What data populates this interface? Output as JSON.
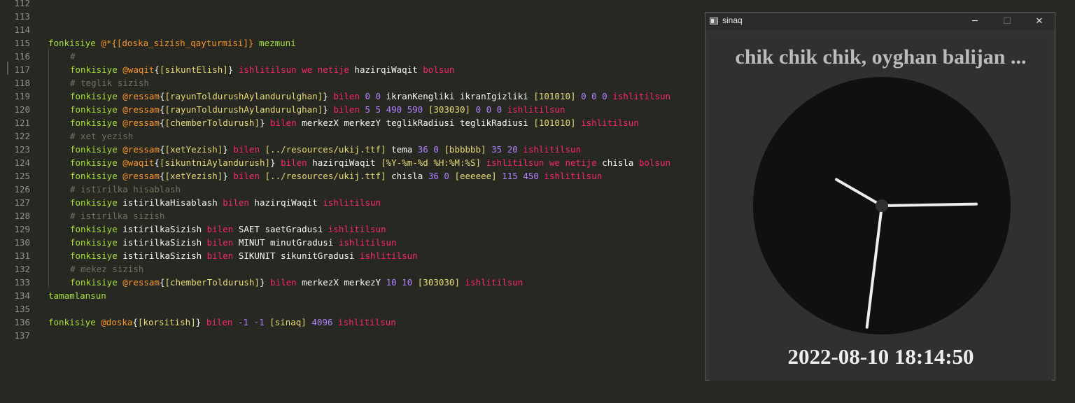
{
  "editor": {
    "lines": [
      {
        "num": "112",
        "indent": false,
        "tokens": []
      },
      {
        "num": "113",
        "indent": false,
        "tokens": []
      },
      {
        "num": "114",
        "indent": false,
        "tokens": []
      },
      {
        "num": "115",
        "indent": false,
        "tokens": [
          [
            "kw",
            "fonkisiye"
          ],
          [
            "fn",
            " "
          ],
          [
            "an",
            "@*{[doska_sizish_qayturmisi]}"
          ],
          [
            "fn",
            " "
          ],
          [
            "df",
            "mezmuni"
          ]
        ]
      },
      {
        "num": "116",
        "indent": true,
        "tokens": [
          [
            "cm",
            "#"
          ]
        ]
      },
      {
        "num": "117",
        "indent": true,
        "tokens": [
          [
            "kw",
            "fonkisiye"
          ],
          [
            "fn",
            " "
          ],
          [
            "an",
            "@waqit"
          ],
          [
            "fn",
            "{"
          ],
          [
            "st",
            "[sikuntElish]"
          ],
          [
            "fn",
            "}"
          ],
          [
            "fn",
            " "
          ],
          [
            "pk",
            "ishlitilsun we netije"
          ],
          [
            "fn",
            " hazirqiWaqit "
          ],
          [
            "pk",
            "bolsun"
          ]
        ]
      },
      {
        "num": "118",
        "indent": true,
        "tokens": [
          [
            "cm",
            "# teglik sizish"
          ]
        ]
      },
      {
        "num": "119",
        "indent": true,
        "tokens": [
          [
            "kw",
            "fonkisiye"
          ],
          [
            "fn",
            " "
          ],
          [
            "an",
            "@ressam"
          ],
          [
            "fn",
            "{"
          ],
          [
            "st",
            "[rayunToldurushAylandurulghan]"
          ],
          [
            "fn",
            "}"
          ],
          [
            "fn",
            " "
          ],
          [
            "pk",
            "bilen"
          ],
          [
            "fn",
            " "
          ],
          [
            "nm",
            "0 0"
          ],
          [
            "fn",
            " ikranKengliki ikranIgizliki "
          ],
          [
            "st",
            "[101010]"
          ],
          [
            "fn",
            " "
          ],
          [
            "nm",
            "0 0 0"
          ],
          [
            "fn",
            " "
          ],
          [
            "pk",
            "ishlitilsun"
          ]
        ]
      },
      {
        "num": "120",
        "indent": true,
        "tokens": [
          [
            "kw",
            "fonkisiye"
          ],
          [
            "fn",
            " "
          ],
          [
            "an",
            "@ressam"
          ],
          [
            "fn",
            "{"
          ],
          [
            "st",
            "[rayunToldurushAylandurulghan]"
          ],
          [
            "fn",
            "}"
          ],
          [
            "fn",
            " "
          ],
          [
            "pk",
            "bilen"
          ],
          [
            "fn",
            " "
          ],
          [
            "nm",
            "5 5 490 590"
          ],
          [
            "fn",
            " "
          ],
          [
            "st",
            "[303030]"
          ],
          [
            "fn",
            " "
          ],
          [
            "nm",
            "0 0 0"
          ],
          [
            "fn",
            " "
          ],
          [
            "pk",
            "ishlitilsun"
          ]
        ]
      },
      {
        "num": "121",
        "indent": true,
        "tokens": [
          [
            "kw",
            "fonkisiye"
          ],
          [
            "fn",
            " "
          ],
          [
            "an",
            "@ressam"
          ],
          [
            "fn",
            "{"
          ],
          [
            "st",
            "[chemberToldurush]"
          ],
          [
            "fn",
            "}"
          ],
          [
            "fn",
            " "
          ],
          [
            "pk",
            "bilen"
          ],
          [
            "fn",
            " merkezX merkezY teglikRadiusi teglikRadiusi "
          ],
          [
            "st",
            "[101010]"
          ],
          [
            "fn",
            " "
          ],
          [
            "pk",
            "ishlitilsun"
          ]
        ]
      },
      {
        "num": "122",
        "indent": true,
        "tokens": [
          [
            "cm",
            "# xet yezish"
          ]
        ]
      },
      {
        "num": "123",
        "indent": true,
        "tokens": [
          [
            "kw",
            "fonkisiye"
          ],
          [
            "fn",
            " "
          ],
          [
            "an",
            "@ressam"
          ],
          [
            "fn",
            "{"
          ],
          [
            "st",
            "[xetYezish]"
          ],
          [
            "fn",
            "}"
          ],
          [
            "fn",
            " "
          ],
          [
            "pk",
            "bilen"
          ],
          [
            "fn",
            " "
          ],
          [
            "st",
            "[../resources/ukij.ttf]"
          ],
          [
            "fn",
            " tema "
          ],
          [
            "nm",
            "36 0"
          ],
          [
            "fn",
            " "
          ],
          [
            "st",
            "[bbbbbb]"
          ],
          [
            "fn",
            " "
          ],
          [
            "nm",
            "35 20"
          ],
          [
            "fn",
            " "
          ],
          [
            "pk",
            "ishlitilsun"
          ]
        ]
      },
      {
        "num": "124",
        "indent": true,
        "tokens": [
          [
            "kw",
            "fonkisiye"
          ],
          [
            "fn",
            " "
          ],
          [
            "an",
            "@waqit"
          ],
          [
            "fn",
            "{"
          ],
          [
            "st",
            "[sikuntniAylandurush]"
          ],
          [
            "fn",
            "}"
          ],
          [
            "fn",
            " "
          ],
          [
            "pk",
            "bilen"
          ],
          [
            "fn",
            " hazirqiWaqit "
          ],
          [
            "st",
            "[%Y-%m-%d %H:%M:%S]"
          ],
          [
            "fn",
            " "
          ],
          [
            "pk",
            "ishlitilsun we netije"
          ],
          [
            "fn",
            " chisla "
          ],
          [
            "pk",
            "bolsun"
          ]
        ]
      },
      {
        "num": "125",
        "indent": true,
        "tokens": [
          [
            "kw",
            "fonkisiye"
          ],
          [
            "fn",
            " "
          ],
          [
            "an",
            "@ressam"
          ],
          [
            "fn",
            "{"
          ],
          [
            "st",
            "[xetYezish]"
          ],
          [
            "fn",
            "}"
          ],
          [
            "fn",
            " "
          ],
          [
            "pk",
            "bilen"
          ],
          [
            "fn",
            " "
          ],
          [
            "st",
            "[../resources/ukij.ttf]"
          ],
          [
            "fn",
            " chisla "
          ],
          [
            "nm",
            "36 0"
          ],
          [
            "fn",
            " "
          ],
          [
            "st",
            "[eeeeee]"
          ],
          [
            "fn",
            " "
          ],
          [
            "nm",
            "115 450"
          ],
          [
            "fn",
            " "
          ],
          [
            "pk",
            "ishlitilsun"
          ]
        ]
      },
      {
        "num": "126",
        "indent": true,
        "tokens": [
          [
            "cm",
            "# istirilka hisablash"
          ]
        ]
      },
      {
        "num": "127",
        "indent": true,
        "tokens": [
          [
            "kw",
            "fonkisiye"
          ],
          [
            "fn",
            " istirilkaHisablash "
          ],
          [
            "pk",
            "bilen"
          ],
          [
            "fn",
            " hazirqiWaqit "
          ],
          [
            "pk",
            "ishlitilsun"
          ]
        ]
      },
      {
        "num": "128",
        "indent": true,
        "tokens": [
          [
            "cm",
            "# istirilka sizish"
          ]
        ]
      },
      {
        "num": "129",
        "indent": true,
        "tokens": [
          [
            "kw",
            "fonkisiye"
          ],
          [
            "fn",
            " istirilkaSizish "
          ],
          [
            "pk",
            "bilen"
          ],
          [
            "fn",
            " SAET saetGradusi "
          ],
          [
            "pk",
            "ishlitilsun"
          ]
        ]
      },
      {
        "num": "130",
        "indent": true,
        "tokens": [
          [
            "kw",
            "fonkisiye"
          ],
          [
            "fn",
            " istirilkaSizish "
          ],
          [
            "pk",
            "bilen"
          ],
          [
            "fn",
            " MINUT minutGradusi "
          ],
          [
            "pk",
            "ishlitilsun"
          ]
        ]
      },
      {
        "num": "131",
        "indent": true,
        "tokens": [
          [
            "kw",
            "fonkisiye"
          ],
          [
            "fn",
            " istirilkaSizish "
          ],
          [
            "pk",
            "bilen"
          ],
          [
            "fn",
            " SIKUNIT sikunitGradusi "
          ],
          [
            "pk",
            "ishlitilsun"
          ]
        ]
      },
      {
        "num": "132",
        "indent": true,
        "tokens": [
          [
            "cm",
            "# mekez sizish"
          ]
        ]
      },
      {
        "num": "133",
        "indent": true,
        "tokens": [
          [
            "kw",
            "fonkisiye"
          ],
          [
            "fn",
            " "
          ],
          [
            "an",
            "@ressam"
          ],
          [
            "fn",
            "{"
          ],
          [
            "st",
            "[chemberToldurush]"
          ],
          [
            "fn",
            "}"
          ],
          [
            "fn",
            " "
          ],
          [
            "pk",
            "bilen"
          ],
          [
            "fn",
            " merkezX merkezY "
          ],
          [
            "nm",
            "10 10"
          ],
          [
            "fn",
            " "
          ],
          [
            "st",
            "[303030]"
          ],
          [
            "fn",
            " "
          ],
          [
            "pk",
            "ishlitilsun"
          ]
        ]
      },
      {
        "num": "134",
        "indent": false,
        "tokens": [
          [
            "kw",
            "tamamlansun"
          ]
        ]
      },
      {
        "num": "135",
        "indent": false,
        "tokens": []
      },
      {
        "num": "136",
        "indent": false,
        "tokens": [
          [
            "kw",
            "fonkisiye"
          ],
          [
            "fn",
            " "
          ],
          [
            "an",
            "@doska"
          ],
          [
            "fn",
            "{"
          ],
          [
            "st",
            "[korsitish]"
          ],
          [
            "fn",
            "}"
          ],
          [
            "fn",
            " "
          ],
          [
            "pk",
            "bilen"
          ],
          [
            "fn",
            " "
          ],
          [
            "nm",
            "-1 -1"
          ],
          [
            "fn",
            " "
          ],
          [
            "st",
            "[sinaq]"
          ],
          [
            "fn",
            " "
          ],
          [
            "nm",
            "4096"
          ],
          [
            "fn",
            " "
          ],
          [
            "pk",
            "ishlitilsun"
          ]
        ]
      },
      {
        "num": "137",
        "indent": false,
        "tokens": []
      }
    ],
    "colors": {
      "background": "#272822",
      "keyword": "#a6e22e",
      "builtin": "#f92672",
      "annotation": "#fd971f",
      "number": "#ae81ff",
      "string": "#e6db74",
      "comment": "#75715e"
    }
  },
  "window": {
    "title": "sinaq",
    "icon": "app-window-icon",
    "minimize_label": "─",
    "maximize_label": "☐",
    "close_label": "✕",
    "canvas": {
      "heading": "chik chik chik, oyghan balijan ...",
      "datetime": "2022-08-10 18:14:50",
      "face_color": "#101010",
      "panel_color": "#303030",
      "heading_color": "#bbbbbb",
      "datetime_color": "#eeeeee",
      "hands": {
        "hour": 18,
        "minute": 14,
        "second": 50
      }
    }
  }
}
